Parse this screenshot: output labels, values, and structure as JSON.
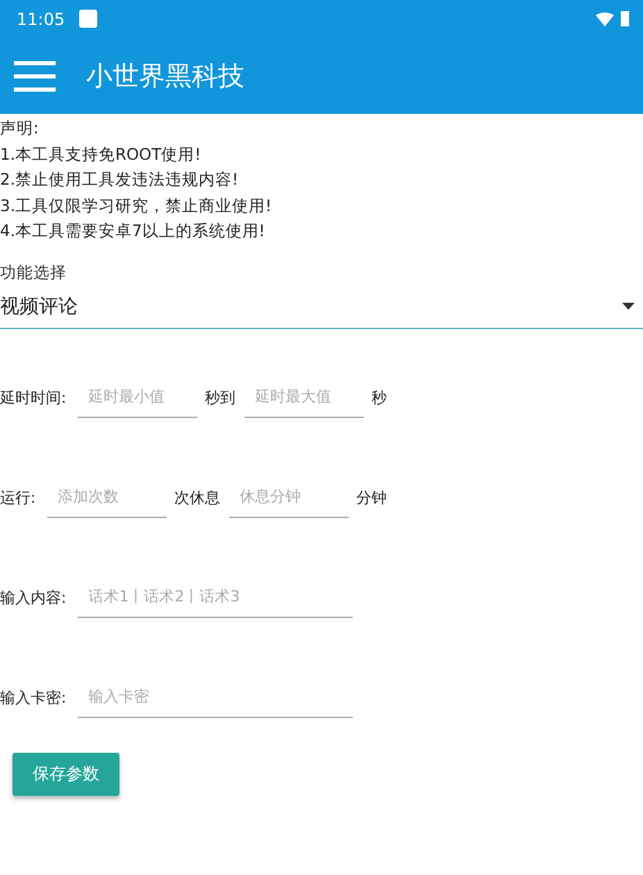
{
  "status_bar": {
    "time": "11:05"
  },
  "app_bar": {
    "title": "小世界黑科技"
  },
  "notice": [
    "声明:",
    "1.本工具支持免ROOT使用!",
    "2.禁止使用工具发违法违规内容!",
    "3.工具仅限学习研究，禁止商业使用!",
    "4.本工具需要安卓7以上的系统使用!"
  ],
  "function_select": {
    "label": "功能选择",
    "value": "视频评论"
  },
  "rows": [
    {
      "label": "延时时间:",
      "parts": [
        {
          "kind": "field",
          "placeholder": "延时最小值"
        },
        {
          "kind": "text",
          "text": "秒到"
        },
        {
          "kind": "field",
          "placeholder": "延时最大值"
        },
        {
          "kind": "text",
          "text": "秒"
        }
      ]
    },
    {
      "label": "运行:",
      "parts": [
        {
          "kind": "field",
          "placeholder": "添加次数"
        },
        {
          "kind": "text",
          "text": "次休息"
        },
        {
          "kind": "field",
          "placeholder": "休息分钟"
        },
        {
          "kind": "text",
          "text": "分钟"
        }
      ]
    },
    {
      "label": "输入内容:",
      "parts": [
        {
          "kind": "wide-field",
          "placeholder": "话术1丨话术2丨话术3"
        }
      ]
    },
    {
      "label": "输入卡密:",
      "parts": [
        {
          "kind": "wide-field",
          "placeholder": "输入卡密"
        }
      ]
    }
  ],
  "save_button": "保存参数"
}
